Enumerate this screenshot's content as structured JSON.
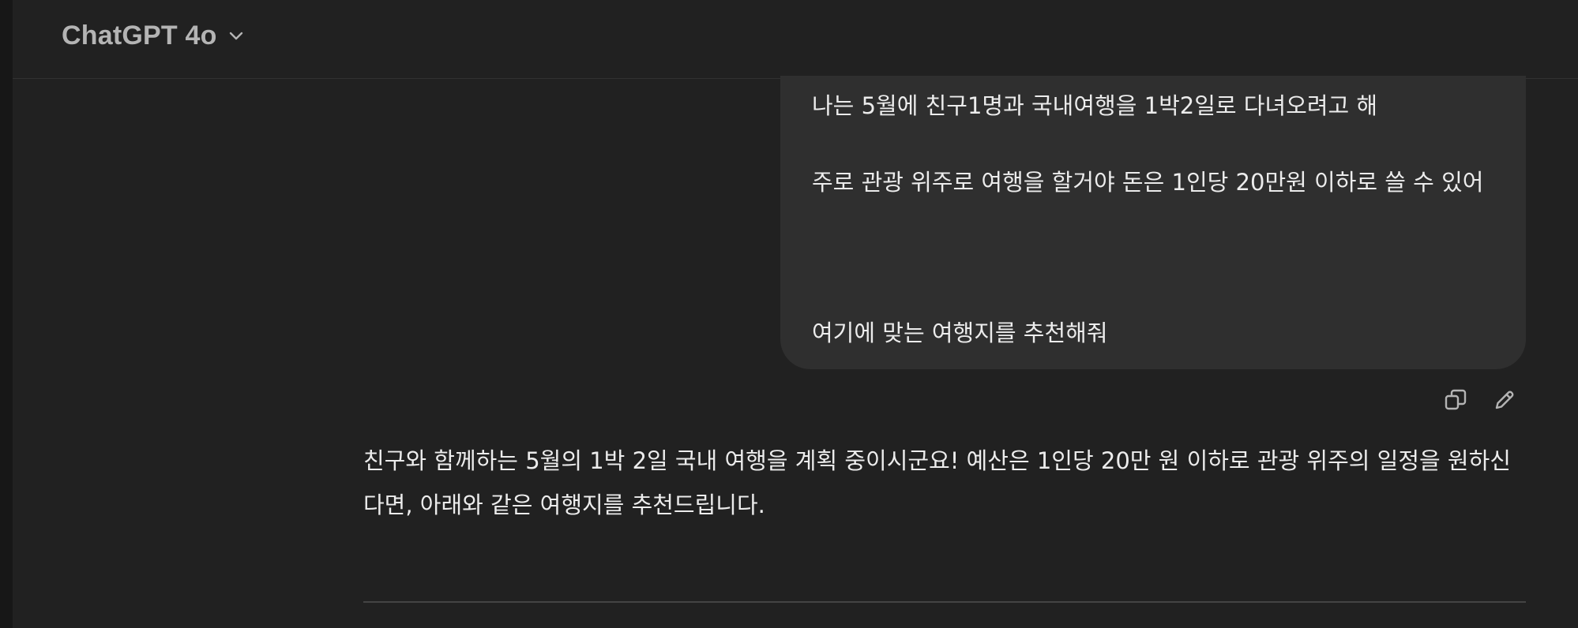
{
  "header": {
    "model_label": "ChatGPT 4o",
    "model_chevron_icon": "chevron-down-icon"
  },
  "user_message": {
    "line1": "나는 5월에 친구1명과 국내여행을 1박2일로 다녀오려고 해",
    "line2": "주로 관광 위주로 여행을 할거야 돈은 1인당 20만원 이하로 쓸 수 있어",
    "line3": "여기에 맞는 여행지를 추천해줘"
  },
  "message_actions": {
    "copy_icon": "copy-icon",
    "edit_icon": "pencil-icon"
  },
  "assistant_message": {
    "text": "친구와 함께하는 5월의 1박 2일 국내 여행을 계획 중이시군요! 예산은 1인당 20만 원 이하로 관광 위주의 일정을 원하신다면, 아래와 같은 여행지를 추천드립니다."
  },
  "colors": {
    "background": "#212121",
    "bubble": "#2f2f2f",
    "text": "#ececec",
    "muted_text": "#b4b4b4"
  }
}
